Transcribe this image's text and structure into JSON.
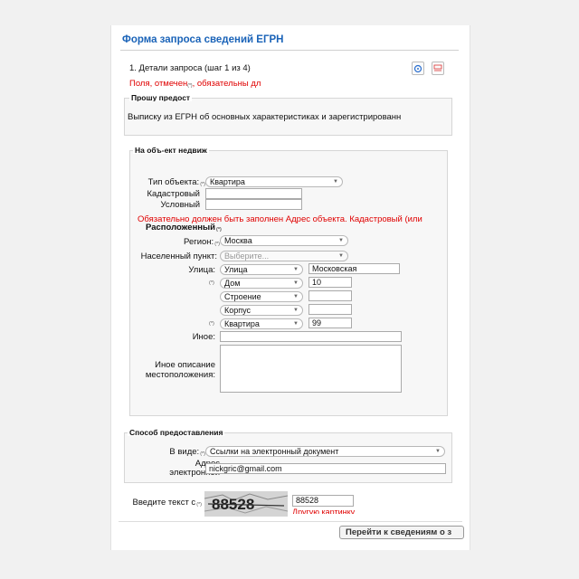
{
  "form": {
    "title": "Форма запроса сведений ЕГРН",
    "step": "1. Детали запроса (шаг 1 из 4)",
    "required_note": "Поля, отмечен",
    "required_note_tail": ", обязательны дл",
    "help_mark": "(*)",
    "icons": [
      "help-icon",
      "pdf-icon"
    ]
  },
  "request_section": {
    "legend": "Прошу предост",
    "text": "Выписку из ЕГРН об основных характеристиках и зарегистрированн"
  },
  "object_section": {
    "legend": "На объ-ект недвиж",
    "type_label": "Тип объекта:",
    "type_value": "Квартира",
    "cadastral_label": "Кадастровый",
    "cadastral_value": "",
    "conditional_label": "Условный",
    "conditional_value": "",
    "error_text": "Обязательно должен быть заполнен Адрес объекта. Кадастровый (или",
    "location_label": "Расположенный",
    "region_label": "Регион:",
    "region_value": "Москва",
    "locality_label": "Населенный пункт:",
    "locality_placeholder": "Выберите...",
    "street_label": "Улица:",
    "street_type": "Улица",
    "street_value": "Московская",
    "house_type": "Дом",
    "house_value": "10",
    "building_type": "Строение",
    "building_value": "",
    "corpus_type": "Корпус",
    "corpus_value": "",
    "apartment_type": "Квартира",
    "apartment_value": "99",
    "other_label": "Иное:",
    "other_value": "",
    "other_desc_label_1": "Иное описание",
    "other_desc_label_2": "местоположения:"
  },
  "delivery_section": {
    "legend": "Способ предоставления",
    "form_label": "В виде:",
    "form_value": "Ссылки на электронный документ",
    "email_label_1": "Адрес",
    "email_label_2": "электронной",
    "email_value": "nickgric@gmail.com"
  },
  "captcha": {
    "label": "Введите текст с",
    "image_text": "88528",
    "input_value": "88528",
    "refresh_link": "Другую картинку"
  },
  "buttons": {
    "next": "Перейти к сведениям о з"
  }
}
